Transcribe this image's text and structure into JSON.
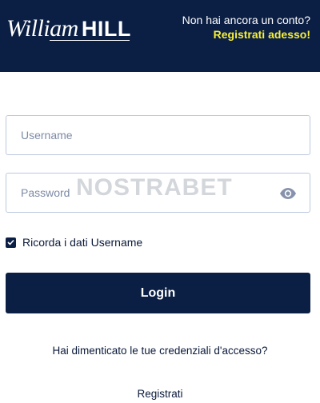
{
  "header": {
    "logo_script": "William",
    "logo_bold": "HILL",
    "no_account_text": "Non hai ancora un conto?",
    "register_now_link": "Registrati adesso!"
  },
  "form": {
    "username_placeholder": "Username",
    "password_placeholder": "Password",
    "remember_label": "Ricorda i dati Username",
    "remember_checked": true,
    "login_label": "Login",
    "forgot_link": "Hai dimenticato le tue credenziali d'accesso?",
    "register_link": "Registrati"
  },
  "watermark": "NOSTRABET",
  "colors": {
    "navy": "#0b1f44",
    "accent_yellow": "#f6ef3a",
    "field_border": "#bcc8df",
    "placeholder": "#7d8aa6"
  },
  "icons": {
    "password_toggle": "eye-icon",
    "checkbox": "checkmark-icon"
  }
}
